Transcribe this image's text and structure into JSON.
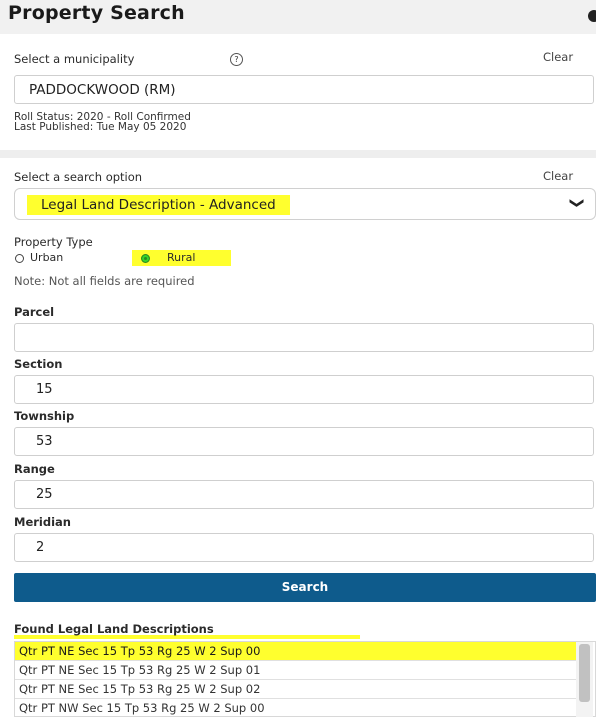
{
  "header": {
    "title": "Property Search"
  },
  "municipality": {
    "label": "Select a municipality",
    "clear_label": "Clear",
    "value": "PADDOCKWOOD (RM)",
    "roll_status": "Roll Status:  2020 - Roll Confirmed",
    "last_published": "Last Published:  Tue May 05 2020",
    "help_icon_glyph": "?"
  },
  "search_option": {
    "label": "Select a search option",
    "clear_label": "Clear",
    "selected": "Legal Land Description - Advanced",
    "chevron": "❯"
  },
  "property_type": {
    "label": "Property Type",
    "options": [
      {
        "label": "Urban",
        "checked": false
      },
      {
        "label": "Rural",
        "checked": true
      }
    ]
  },
  "note": "Note: Not all fields are required",
  "fields": {
    "parcel": {
      "label": "Parcel",
      "value": ""
    },
    "section": {
      "label": "Section",
      "value": "15"
    },
    "township": {
      "label": "Township",
      "value": "53"
    },
    "range": {
      "label": "Range",
      "value": "25"
    },
    "meridian": {
      "label": "Meridian",
      "value": "2"
    }
  },
  "search_button": {
    "label": "Search"
  },
  "results": {
    "label": "Found Legal Land Descriptions",
    "items": [
      "Qtr PT NE Sec 15 Tp 53 Rg 25 W 2 Sup 00",
      "Qtr PT NE Sec 15 Tp 53 Rg 25 W 2 Sup 01",
      "Qtr PT NE Sec 15 Tp 53 Rg 25 W 2 Sup 02",
      "Qtr PT NW Sec 15 Tp 53 Rg 25 W 2 Sup 00"
    ],
    "selected_index": 0
  },
  "colors": {
    "highlight": "#ffff2e",
    "button": "#0e5b8c",
    "radio_checked": "#37d52a"
  }
}
